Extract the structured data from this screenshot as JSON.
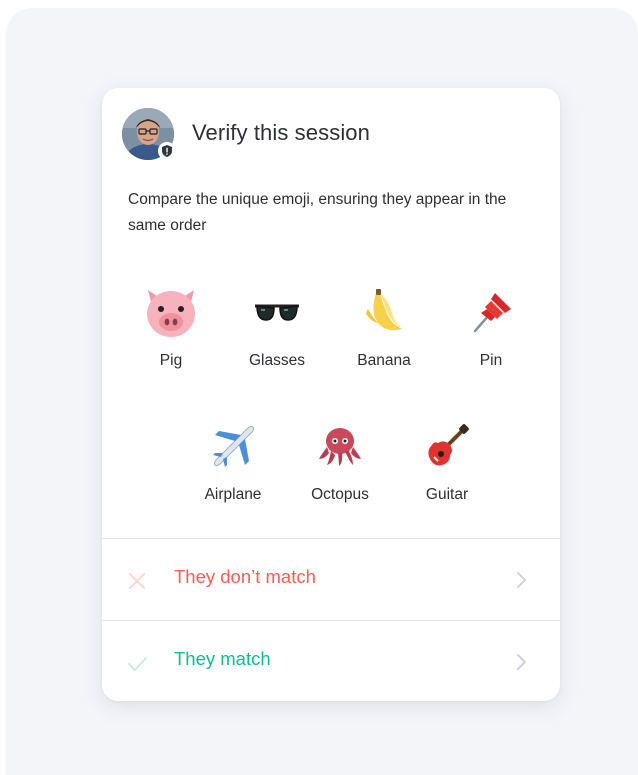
{
  "dialog": {
    "title": "Verify this session",
    "description": "Compare the unique emoji, ensuring they appear in the same order"
  },
  "emojis": [
    {
      "label": "Pig",
      "icon": "pig-icon"
    },
    {
      "label": "Glasses",
      "icon": "glasses-icon"
    },
    {
      "label": "Banana",
      "icon": "banana-icon"
    },
    {
      "label": "Pin",
      "icon": "pin-icon"
    },
    {
      "label": "Airplane",
      "icon": "airplane-icon"
    },
    {
      "label": "Octopus",
      "icon": "octopus-icon"
    },
    {
      "label": "Guitar",
      "icon": "guitar-icon"
    }
  ],
  "actions": {
    "no_match": {
      "label": "They don’t match",
      "color": "#ff5b55",
      "icon": "close-icon"
    },
    "match": {
      "label": "They match",
      "color": "#0dbd8b",
      "icon": "check-icon"
    }
  }
}
